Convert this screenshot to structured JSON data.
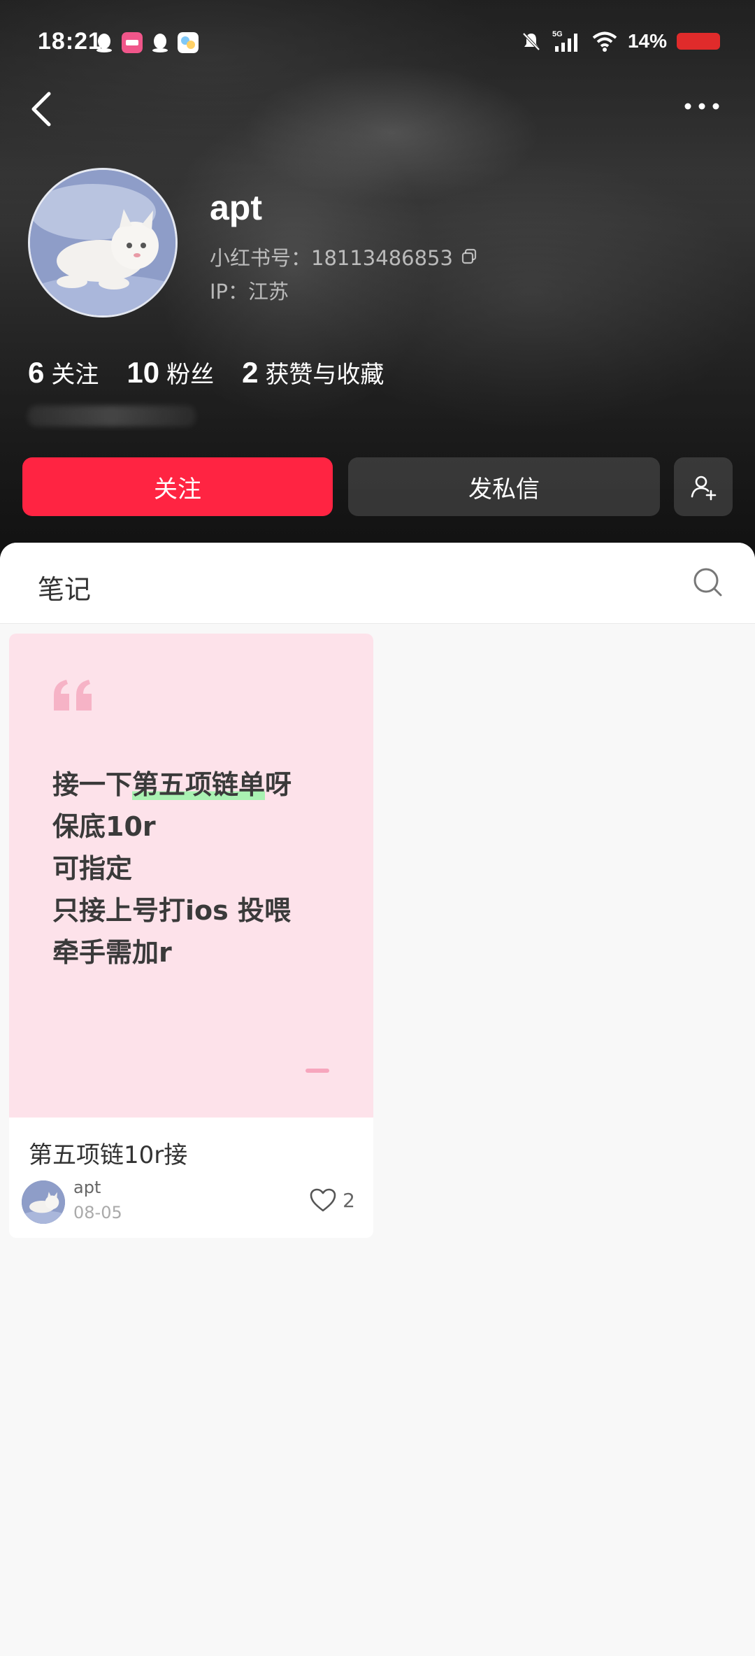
{
  "status_bar": {
    "time": "18:21",
    "network": "5G",
    "battery_percent": "14%",
    "battery_color": "#e02b2b",
    "app_icons": [
      "qq-icon",
      "lofter-icon",
      "qq-icon",
      "app-icon"
    ]
  },
  "profile": {
    "username": "apt",
    "red_id": "小红书号：18113486853",
    "ip_location": "IP：江苏",
    "stats": [
      {
        "value": "6",
        "label": "关注"
      },
      {
        "value": "10",
        "label": "粉丝"
      },
      {
        "value": "2",
        "label": "获赞与收藏"
      }
    ]
  },
  "actions": {
    "follow_label": "关注",
    "message_label": "发私信",
    "accent_color": "#ff2442"
  },
  "tabs": {
    "notes_label": "笔记"
  },
  "notes": [
    {
      "cover_lines": [
        "接一下",
        "第五项链单",
        "呀",
        "保底10r",
        "可指定",
        "只接上号打ios 投喂",
        "牵手需加r"
      ],
      "title": "第五项链10r接",
      "author": "apt",
      "date": "08-05",
      "likes": "2"
    }
  ]
}
